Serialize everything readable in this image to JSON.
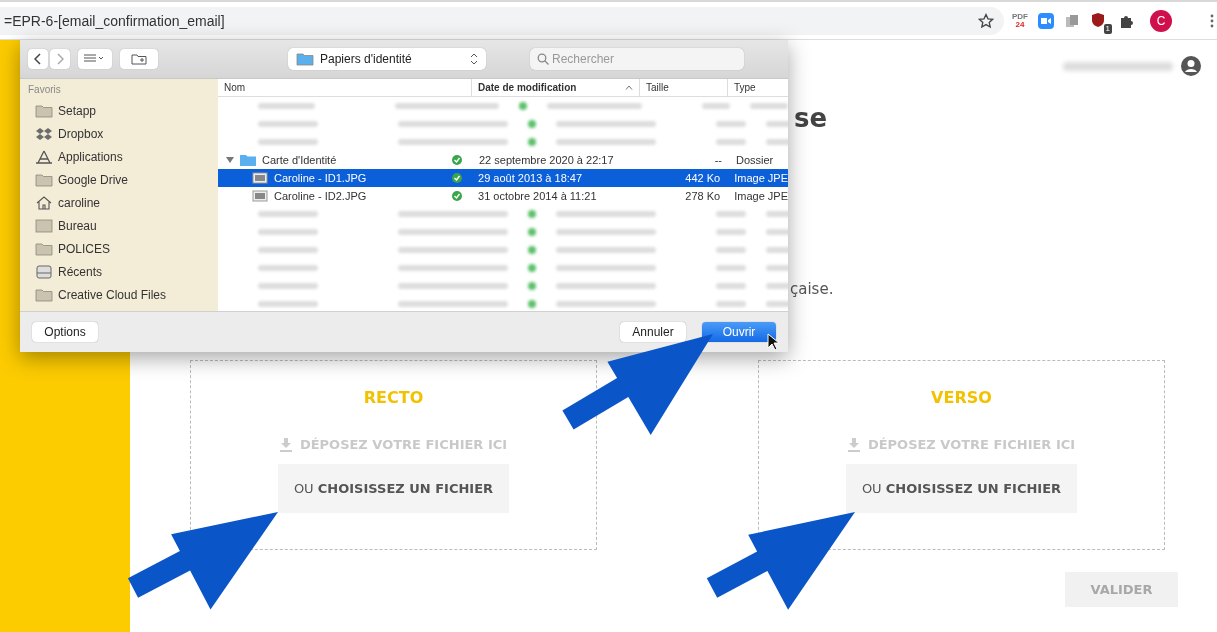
{
  "browser": {
    "address": "=EPR-6-[email_confirmation_email]",
    "pdf_icon_text": [
      "PDF",
      "24"
    ],
    "extension_badge": "1",
    "avatar_letter": "C"
  },
  "page": {
    "heading_fragment": "se",
    "text_fragment": "çaise.",
    "upload_zones": [
      {
        "title": "RECTO",
        "drop_label": "DÉPOSEZ VOTRE FICHIER ICI",
        "choose_label": "OU **CHOISISSEZ UN FICHIER**"
      },
      {
        "title": "VERSO",
        "drop_label": "DÉPOSEZ VOTRE FICHIER ICI",
        "choose_label": "OU **CHOISISSEZ UN FICHIER**"
      }
    ],
    "submit_button": {
      "label": "VALIDER",
      "disabled": true
    }
  },
  "dialog": {
    "location": "Papiers d'identité",
    "search": {
      "placeholder": "Rechercher"
    },
    "sidebar": {
      "heading": "Favoris",
      "items": [
        {
          "kind": "folder",
          "label": "Setapp"
        },
        {
          "kind": "dropbox",
          "label": "Dropbox"
        },
        {
          "kind": "apps",
          "label": "Applications"
        },
        {
          "kind": "folder",
          "label": "Google Drive"
        },
        {
          "kind": "home",
          "label": "caroline"
        },
        {
          "kind": "desktop",
          "label": "Bureau"
        },
        {
          "kind": "folder",
          "label": "POLICES"
        },
        {
          "kind": "recents",
          "label": "Récents"
        },
        {
          "kind": "folder",
          "label": "Creative Cloud Files"
        }
      ]
    },
    "columns": [
      {
        "label": "Nom",
        "sorted": false
      },
      {
        "label": "Date de modification",
        "sorted": true
      },
      {
        "label": "Taille",
        "sorted": false
      },
      {
        "label": "Type",
        "sorted": false
      }
    ],
    "rows": [
      {
        "kind": "blurred",
        "selected": false
      },
      {
        "kind": "blurred",
        "selected": false
      },
      {
        "kind": "blurred",
        "selected": false
      },
      {
        "kind": "folder",
        "name": "Carte d'Identité",
        "date": "22 septembre 2020 à 22:17",
        "size": "--",
        "type": "Dossier",
        "expanded": true,
        "selected": false
      },
      {
        "kind": "image",
        "name": "Caroline - ID1.JPG",
        "date": "29 août 2013 à 18:47",
        "size": "442 Ko",
        "type": "Image JPE",
        "selected": true
      },
      {
        "kind": "image",
        "name": "Caroline - ID2.JPG",
        "date": "31 octobre 2014 à 11:21",
        "size": "278 Ko",
        "type": "Image JPE",
        "selected": false
      },
      {
        "kind": "blurred",
        "selected": false
      },
      {
        "kind": "blurred",
        "selected": false
      },
      {
        "kind": "blurred",
        "selected": false
      },
      {
        "kind": "blurred",
        "selected": false
      },
      {
        "kind": "blurred",
        "selected": false
      },
      {
        "kind": "blurred",
        "selected": false
      }
    ],
    "buttons": [
      {
        "kind": "secondary",
        "label": "Options"
      },
      {
        "kind": "secondary",
        "label": "Annuler"
      },
      {
        "kind": "primary",
        "label": "Ouvrir"
      }
    ]
  }
}
